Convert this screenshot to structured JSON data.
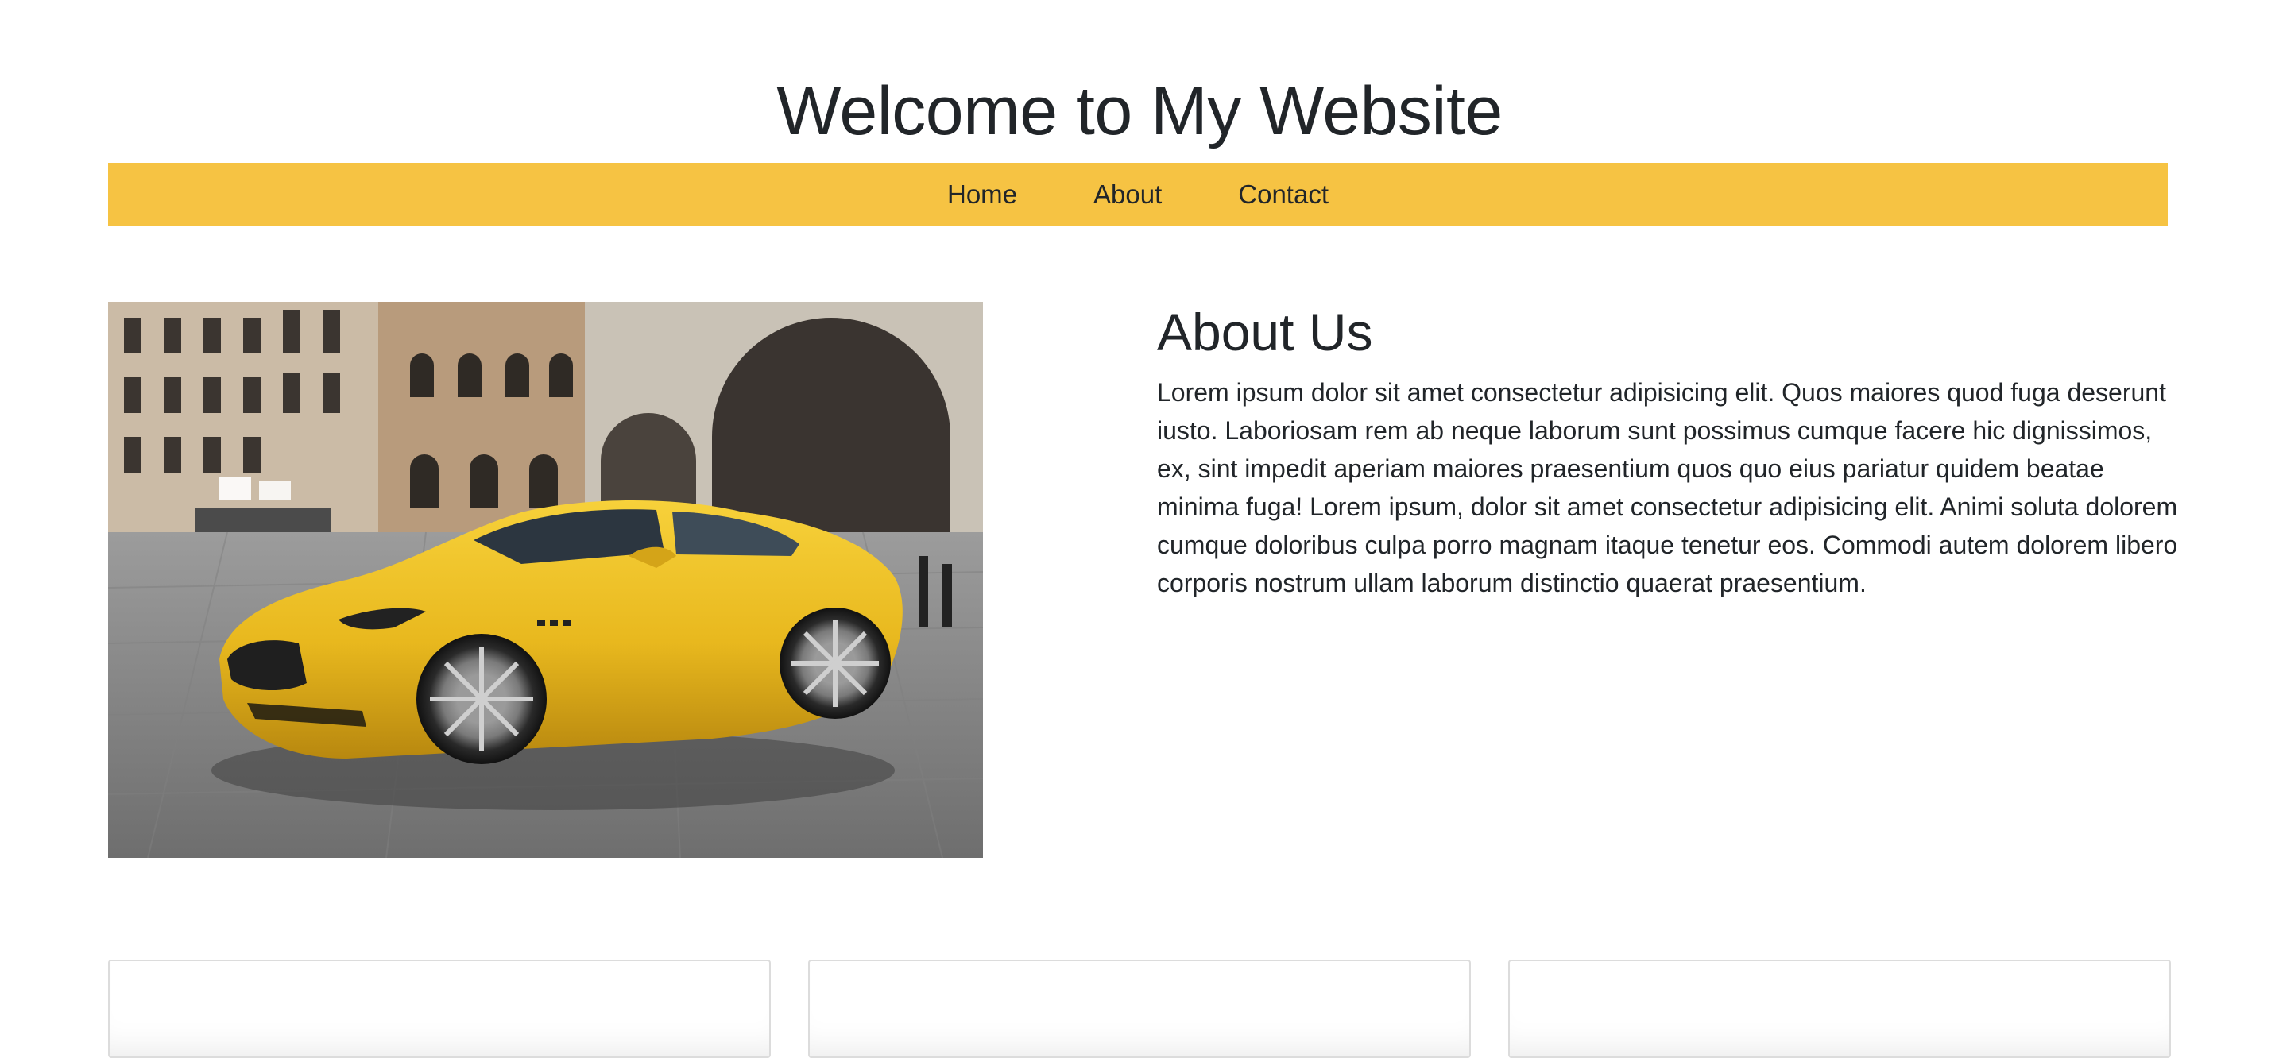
{
  "header": {
    "title": "Welcome to My Website"
  },
  "nav": {
    "items": [
      {
        "label": "Home"
      },
      {
        "label": "About"
      },
      {
        "label": "Contact"
      }
    ]
  },
  "hero": {
    "image_subject": "yellow sports car in a stone piazza"
  },
  "about": {
    "heading": "About Us",
    "body": "Lorem ipsum dolor sit amet consectetur adipisicing elit. Quos maiores quod fuga deserunt iusto. Laboriosam rem ab neque laborum sunt possimus cumque facere hic dignissimos, ex, sint impedit aperiam maiores praesentium quos quo eius pariatur quidem beatae minima fuga! Lorem ipsum, dolor sit amet consectetur adipisicing elit. Animi soluta dolorem cumque doloribus culpa porro magnam itaque tenetur eos. Commodi autem dolorem libero corporis nostrum ullam laborum distinctio quaerat praesentium."
  },
  "colors": {
    "nav_background": "#f6c343",
    "text": "#212529"
  }
}
